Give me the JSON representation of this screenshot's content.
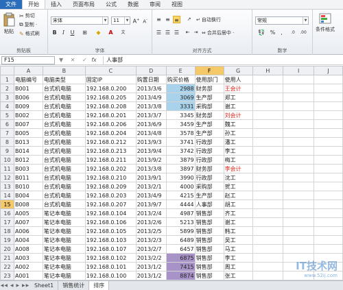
{
  "menu": [
    "文件",
    "开始",
    "插入",
    "页面布局",
    "公式",
    "数据",
    "审阅",
    "视图"
  ],
  "ribbon": {
    "paste": "粘贴",
    "cut": "剪切",
    "copy": "复制 ·",
    "format_painter": "格式刷",
    "clipboard_label": "剪贴板",
    "font_name": "宋体",
    "font_size": "11",
    "font_label": "字体",
    "wrap_text": "自动换行",
    "merge_center": "合并后居中 ·",
    "alignment_label": "对齐方式",
    "number_format": "常规",
    "number_label": "数字",
    "conditional_format": "条件格式"
  },
  "formula_bar": {
    "cell_ref": "F15",
    "fx": "fx",
    "content": "人事部"
  },
  "columns": [
    "A",
    "B",
    "C",
    "D",
    "E",
    "F",
    "G",
    "H",
    "I",
    "J"
  ],
  "selected_column": "F",
  "selected_row": "15",
  "headers": [
    "电脑编号",
    "电脑类型",
    "固定IP",
    "购置日期",
    "购买价格",
    "使用部门",
    "使用人"
  ],
  "rows": [
    [
      "B001",
      "台式机电脑",
      "192.168.0.200",
      "2013/3/6",
      "2988",
      "财务部",
      "王会计"
    ],
    [
      "B006",
      "台式机电脑",
      "192.168.0.205",
      "2013/4/9",
      "3069",
      "生产部",
      "郑工"
    ],
    [
      "B009",
      "台式机电脑",
      "192.168.0.208",
      "2013/3/8",
      "3331",
      "采购部",
      "谢工"
    ],
    [
      "B002",
      "台式机电脑",
      "192.168.0.201",
      "2013/3/7",
      "3345",
      "财务部",
      "刘会计"
    ],
    [
      "B007",
      "台式机电脑",
      "192.168.0.206",
      "2013/6/9",
      "3459",
      "生产部",
      "魏工"
    ],
    [
      "B005",
      "台式机电脑",
      "192.168.0.204",
      "2013/4/8",
      "3578",
      "生产部",
      "孙工"
    ],
    [
      "B013",
      "台式机电脑",
      "192.168.0.212",
      "2013/9/3",
      "3741",
      "行政部",
      "潘工"
    ],
    [
      "B014",
      "台式机电脑",
      "192.168.0.213",
      "2013/9/4",
      "3742",
      "行政部",
      "李工"
    ],
    [
      "B012",
      "台式机电脑",
      "192.168.0.211",
      "2013/9/2",
      "3879",
      "行政部",
      "梅工"
    ],
    [
      "B003",
      "台式机电脑",
      "192.168.0.202",
      "2013/3/8",
      "3897",
      "财务部",
      "李会计"
    ],
    [
      "B011",
      "台式机电脑",
      "192.168.0.210",
      "2013/9/1",
      "3990",
      "行政部",
      "沈工"
    ],
    [
      "B010",
      "台式机电脑",
      "192.168.0.209",
      "2013/2/1",
      "4000",
      "采购部",
      "贺工"
    ],
    [
      "B004",
      "台式机电脑",
      "192.168.0.203",
      "2013/4/9",
      "4215",
      "生产部",
      "赵工"
    ],
    [
      "B008",
      "台式机电脑",
      "192.168.0.207",
      "2013/9/7",
      "4444",
      "人事部",
      "胡工"
    ],
    [
      "A005",
      "笔记本电脑",
      "192.168.0.104",
      "2013/2/4",
      "4987",
      "销售部",
      "齐工"
    ],
    [
      "A007",
      "笔记本电脑",
      "192.168.0.106",
      "2013/2/6",
      "5213",
      "销售部",
      "谢工"
    ],
    [
      "A006",
      "笔记本电脑",
      "192.168.0.105",
      "2013/2/5",
      "5899",
      "销售部",
      "韩工"
    ],
    [
      "A004",
      "笔记本电脑",
      "192.168.0.103",
      "2013/2/3",
      "6489",
      "销售部",
      "吴工"
    ],
    [
      "A008",
      "笔记本电脑",
      "192.168.0.107",
      "2013/2/7",
      "6457",
      "销售部",
      "马工"
    ],
    [
      "A003",
      "笔记本电脑",
      "192.168.0.102",
      "2013/2/2",
      "6875",
      "销售部",
      "李工"
    ],
    [
      "A002",
      "笔记本电脑",
      "192.168.0.101",
      "2013/1/2",
      "7415",
      "销售部",
      "周工"
    ],
    [
      "A001",
      "笔记本电脑",
      "192.168.0.100",
      "2013/1/2",
      "8874",
      "销售部",
      "张工"
    ]
  ],
  "highlight": {
    "blue_rows": [
      2,
      3,
      4
    ],
    "purple_rows": [
      21,
      22,
      23
    ],
    "red_user_rows": [
      2,
      5,
      11
    ],
    "colors": {
      "blue": "#a9d3ea",
      "purple": "#a893c8",
      "red_text": "#d9261c",
      "selected_header": "#f5c86a"
    }
  },
  "sheet_tabs": [
    "Sheet1",
    "销售统计",
    "排序"
  ],
  "active_tab": "排序",
  "watermark": {
    "title": "IT技术网",
    "url": "www.52ij.com"
  }
}
